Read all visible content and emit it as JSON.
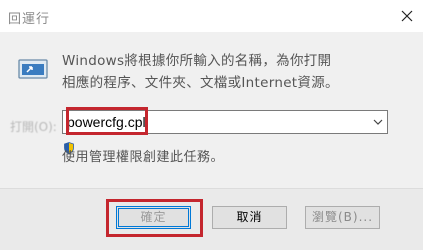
{
  "window": {
    "title": "回運行"
  },
  "description": {
    "line1": "Windows將根據你所輸入的名稱，為你打開",
    "line2": "相應的程序、文件夾、文檔或Internet資源。"
  },
  "open_field": {
    "label": "打開(O):",
    "value": "powercfg.cpl"
  },
  "admin_note": "使用管理權限創建此任務。",
  "buttons": {
    "ok": "確定",
    "cancel": "取消",
    "browse": "瀏覽(B)..."
  },
  "colors": {
    "highlight": "#c4262e",
    "focus": "#0078d7"
  },
  "icons": [
    "run-icon",
    "close-icon",
    "chevron-down-icon",
    "shield-icon"
  ]
}
